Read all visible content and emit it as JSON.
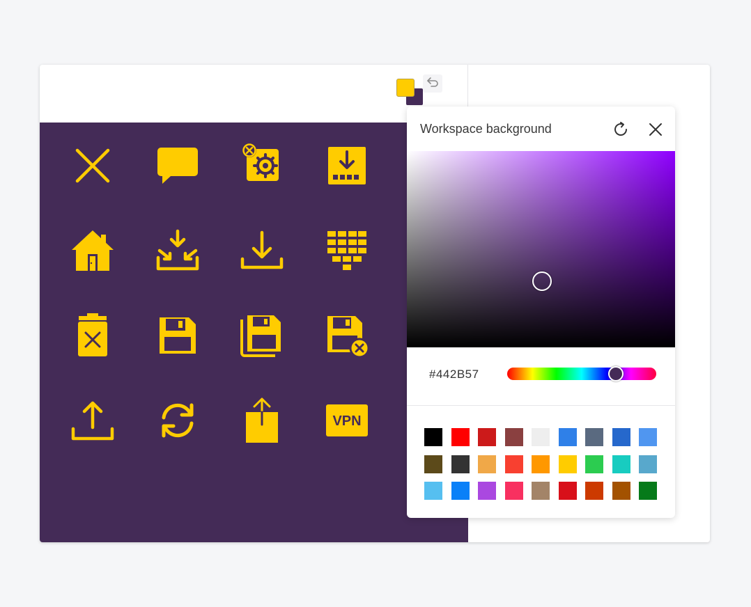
{
  "toolbar": {
    "foreground_color": "#ffcc00",
    "background_color": "#442b57",
    "swap_icon": "swap-colors-icon"
  },
  "workspace": {
    "background": "#442b57",
    "icon_color": "#ffcc00",
    "icons": [
      "close-icon",
      "chat-bubble-icon",
      "settings-remove-icon",
      "download-box-icon",
      "home-icon",
      "import-icon",
      "download-icon",
      "keypad-icon",
      "delete-bin-icon",
      "save-icon",
      "save-all-icon",
      "save-cancel-icon",
      "upload-icon",
      "sync-icon",
      "share-icon",
      "vpn-icon"
    ],
    "vpn_label": "VPN"
  },
  "picker": {
    "title": "Workspace background",
    "hex_value": "#442B57",
    "reset_icon": "reset-icon",
    "close_icon": "close-icon",
    "hue_base": "#8f00ff",
    "palette": [
      "#000000",
      "#ff0000",
      "#cc1a1a",
      "#8a4040",
      "#eeeeee",
      "#2f80e8",
      "#5a6a80",
      "#2668cc",
      "#5096f0",
      "#5c4a1a",
      "#333333",
      "#f0a848",
      "#f84030",
      "#ff9800",
      "#ffcc00",
      "#2ccc50",
      "#18ccc0",
      "#58a8cc",
      "#56bff0",
      "#0a80f8",
      "#aa48e0",
      "#f83060",
      "#a38468",
      "#d8101a",
      "#cc3a00",
      "#a35200",
      "#067a1a"
    ]
  }
}
